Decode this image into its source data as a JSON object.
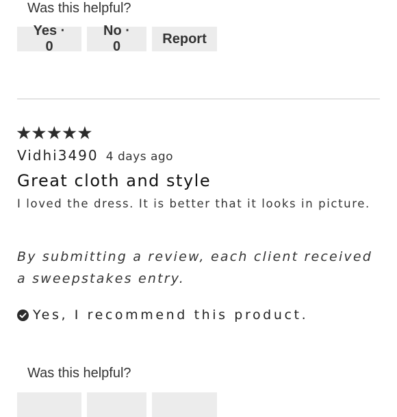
{
  "helpful_prompt_top": "Was this helpful?",
  "top_buttons": {
    "yes": "Yes · 0",
    "no": "No · 0",
    "report": "Report"
  },
  "review": {
    "rating": 5,
    "stars_text": "★★★★★",
    "reviewer": "Vidhi3490",
    "date": "4 days ago",
    "title": "Great cloth and style",
    "body": "I loved the dress. It is better that it looks in picture.",
    "sweepstakes_note": "By submitting a review, each client received a sweepstakes entry.",
    "recommend_text": "Yes, I recommend this product."
  },
  "helpful_prompt_bottom": "Was this helpful?"
}
